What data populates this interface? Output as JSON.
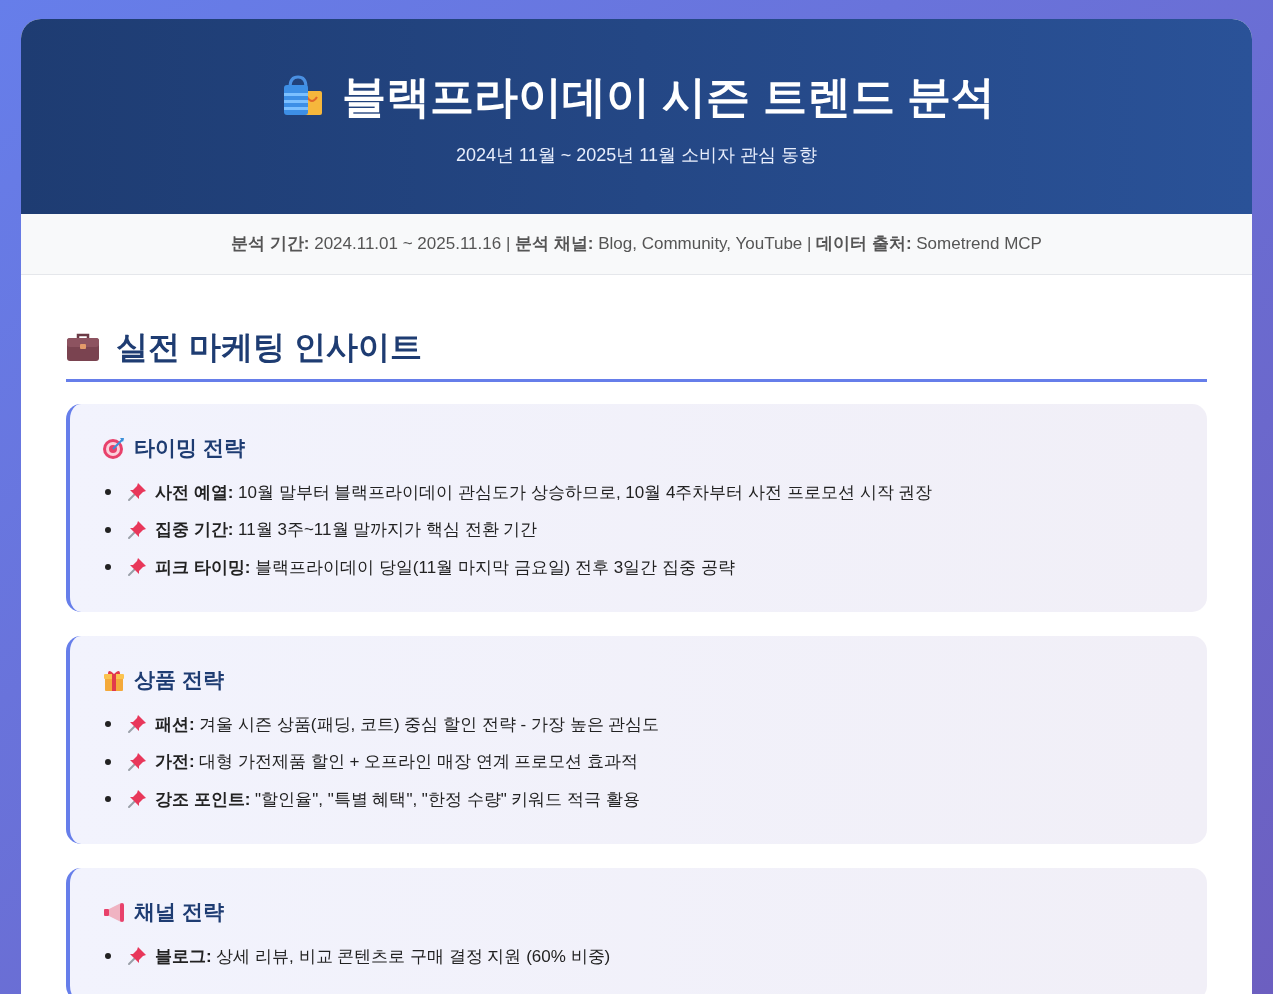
{
  "header": {
    "title": "블랙프라이데이 시즌 트렌드 분석",
    "subtitle": "2024년 11월 ~ 2025년 11월 소비자 관심 동향"
  },
  "meta": "**분석 기간:** 2024.11.01 ~ 2025.11.16 | **분석 채널:** Blog, Community, YouTube | **데이터 출처:** Sometrend MCP",
  "section": {
    "title": "실전 마케팅 인사이트",
    "cards": [
      {
        "title": "타이밍 전략",
        "items": [
          "**사전 예열:** 10월 말부터 블랙프라이데이 관심도가 상승하므로, 10월 4주차부터 사전 프로모션 시작 권장",
          "**집중 기간:** 11월 3주~11월 말까지가 핵심 전환 기간",
          "**피크 타이밍:** 블랙프라이데이 당일(11월 마지막 금요일) 전후 3일간 집중 공략"
        ]
      },
      {
        "title": "상품 전략",
        "items": [
          "**패션:** 겨울 시즌 상품(패딩, 코트) 중심 할인 전략 - 가장 높은 관심도",
          "**가전:** 대형 가전제품 할인 + 오프라인 매장 연계 프로모션 효과적",
          "**강조 포인트:** \"할인율\", \"특별 혜택\", \"한정 수량\" 키워드 적극 활용"
        ]
      },
      {
        "title": "채널 전략",
        "items": [
          "**블로그:** 상세 리뷰, 비교 콘텐츠로 구매 결정 지원 (60% 비중)"
        ]
      }
    ]
  }
}
